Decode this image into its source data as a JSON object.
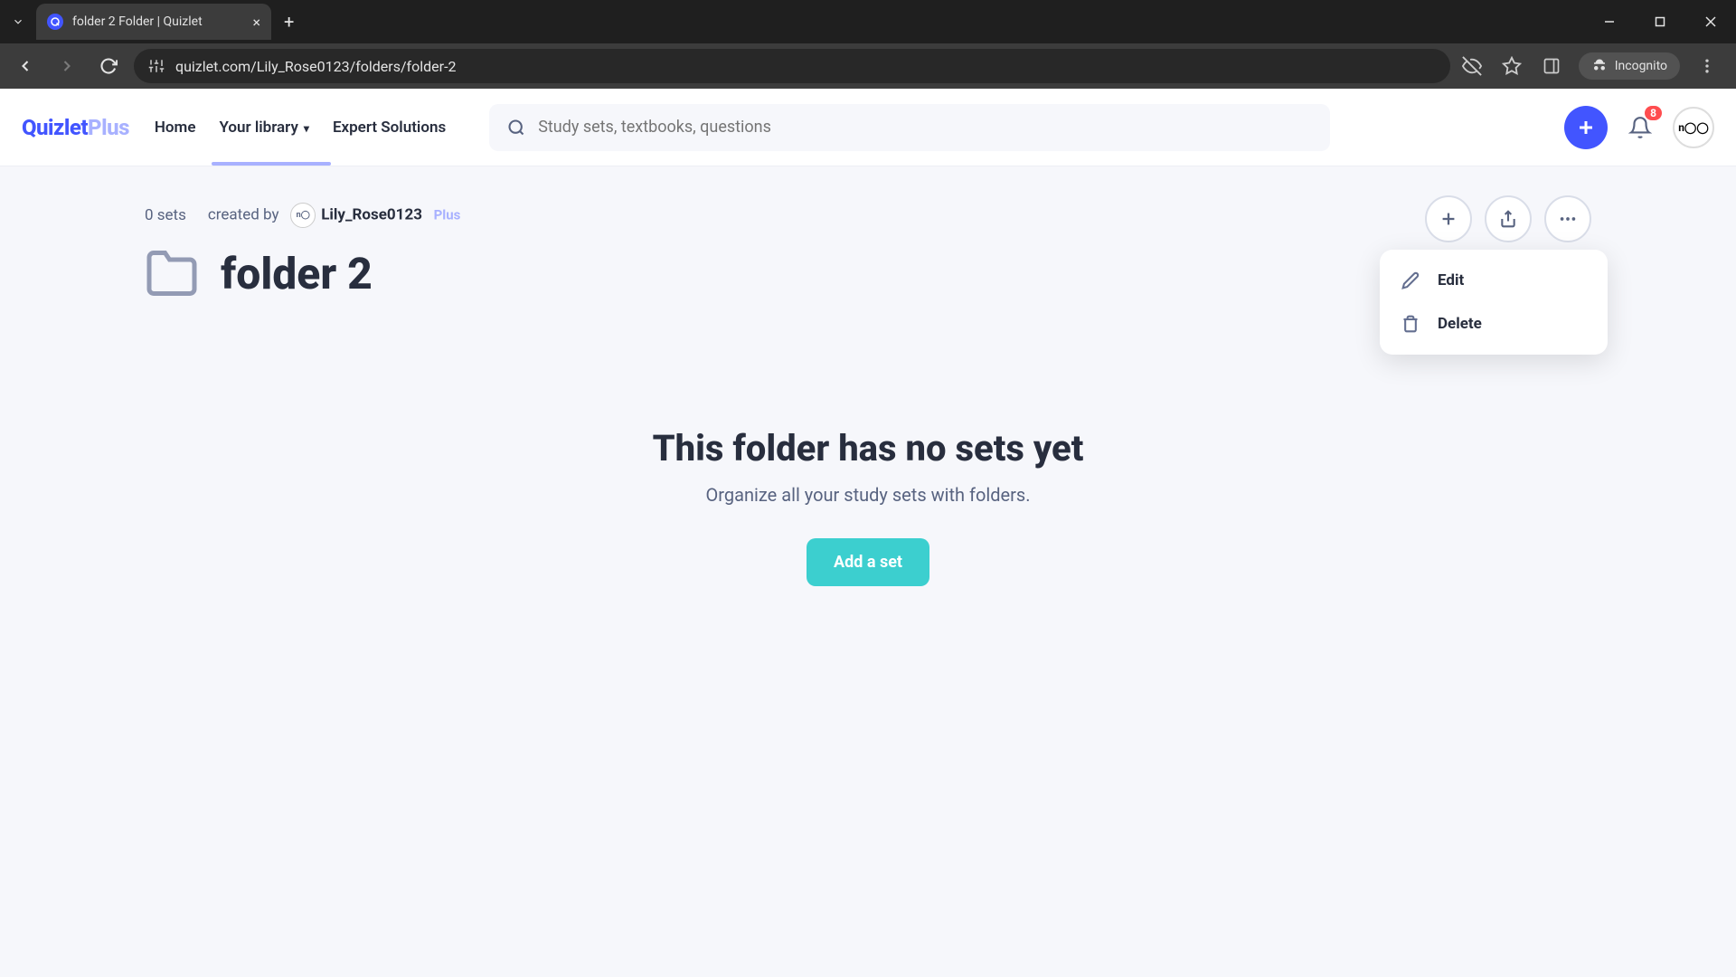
{
  "browser": {
    "tab_title": "folder 2 Folder | Quizlet",
    "url": "quizlet.com/Lily_Rose0123/folders/folder-2",
    "incognito_label": "Incognito"
  },
  "header": {
    "logo_main": "Quizlet",
    "logo_plus": "Plus",
    "nav": {
      "home": "Home",
      "library": "Your library",
      "expert": "Expert Solutions"
    },
    "search_placeholder": "Study sets, textbooks, questions",
    "badge_count": "8"
  },
  "folder": {
    "sets_count": "0 sets",
    "created_by_label": "created by",
    "username": "Lily_Rose0123",
    "user_badge": "Plus",
    "title": "folder 2"
  },
  "empty_state": {
    "heading": "This folder has no sets yet",
    "subtext": "Organize all your study sets with folders.",
    "button": "Add a set"
  },
  "dropdown": {
    "edit": "Edit",
    "delete": "Delete"
  }
}
